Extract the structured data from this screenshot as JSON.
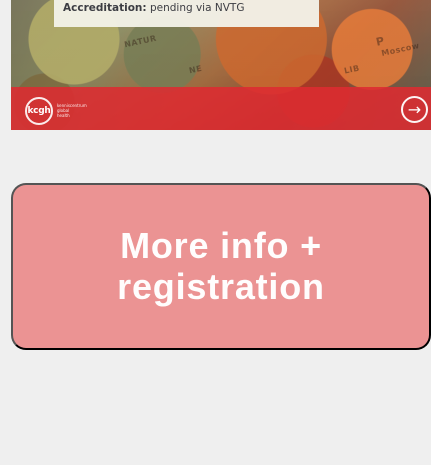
{
  "event_card": {
    "info_label": "Accreditation:",
    "info_value": "pending via NVTG",
    "logo_text": "kcgh",
    "logo_tagline": "kenniscentrum global health",
    "map_labels": [
      "NATUR",
      "NE",
      "LIB",
      "P",
      "Moscow"
    ],
    "arrow_icon": "arrow-right-icon"
  },
  "cta": {
    "label": "More info + registration"
  },
  "colors": {
    "page_background": "#efefef",
    "banner_red": "#dd2b31",
    "cta_background": "#eb9393",
    "text_dark": "#3c3d43",
    "white": "#ffffff"
  }
}
